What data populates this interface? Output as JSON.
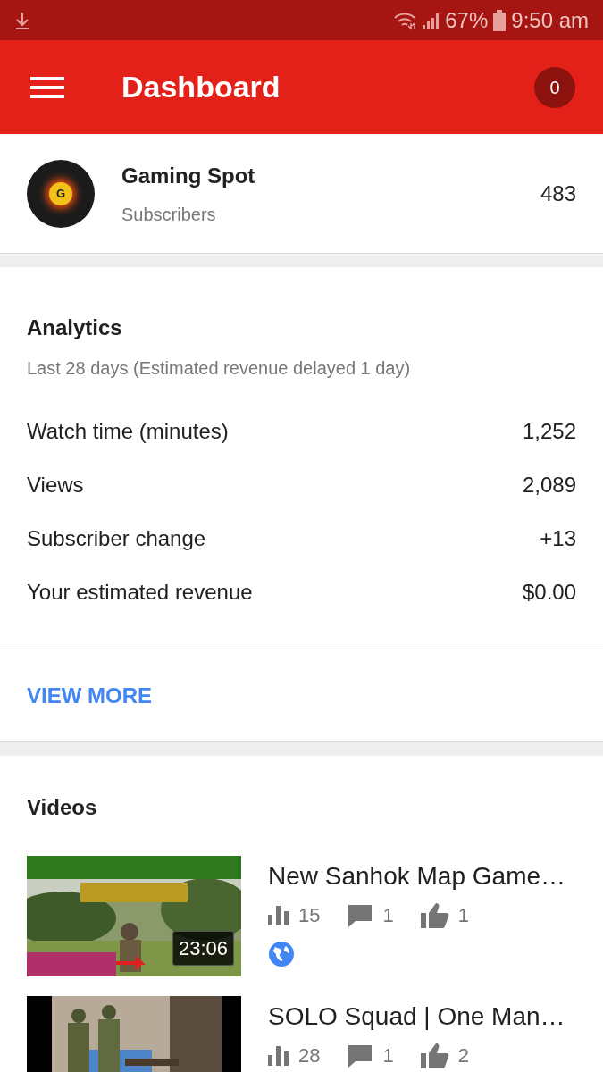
{
  "status_bar": {
    "battery": "67%",
    "time": "9:50 am"
  },
  "app_bar": {
    "title": "Dashboard",
    "notification_count": "0"
  },
  "channel": {
    "name": "Gaming Spot",
    "avatar_letter": "G",
    "subscribers_label": "Subscribers",
    "subscribers": "483"
  },
  "analytics": {
    "title": "Analytics",
    "subtitle": "Last 28 days (Estimated revenue delayed 1 day)",
    "rows": [
      {
        "label": "Watch time (minutes)",
        "value": "1,252"
      },
      {
        "label": "Views",
        "value": "2,089"
      },
      {
        "label": "Subscriber change",
        "value": "+13"
      },
      {
        "label": "Your estimated revenue",
        "value": "$0.00"
      }
    ],
    "link": "VIEW MORE"
  },
  "videos": {
    "title": "Videos",
    "items": [
      {
        "title": "New Sanhok Map Game…",
        "duration": "23:06",
        "views": "15",
        "comments": "1",
        "likes": "1",
        "public": true
      },
      {
        "title": "SOLO Squad | One Man…",
        "views": "28",
        "comments": "1",
        "likes": "2"
      }
    ]
  }
}
